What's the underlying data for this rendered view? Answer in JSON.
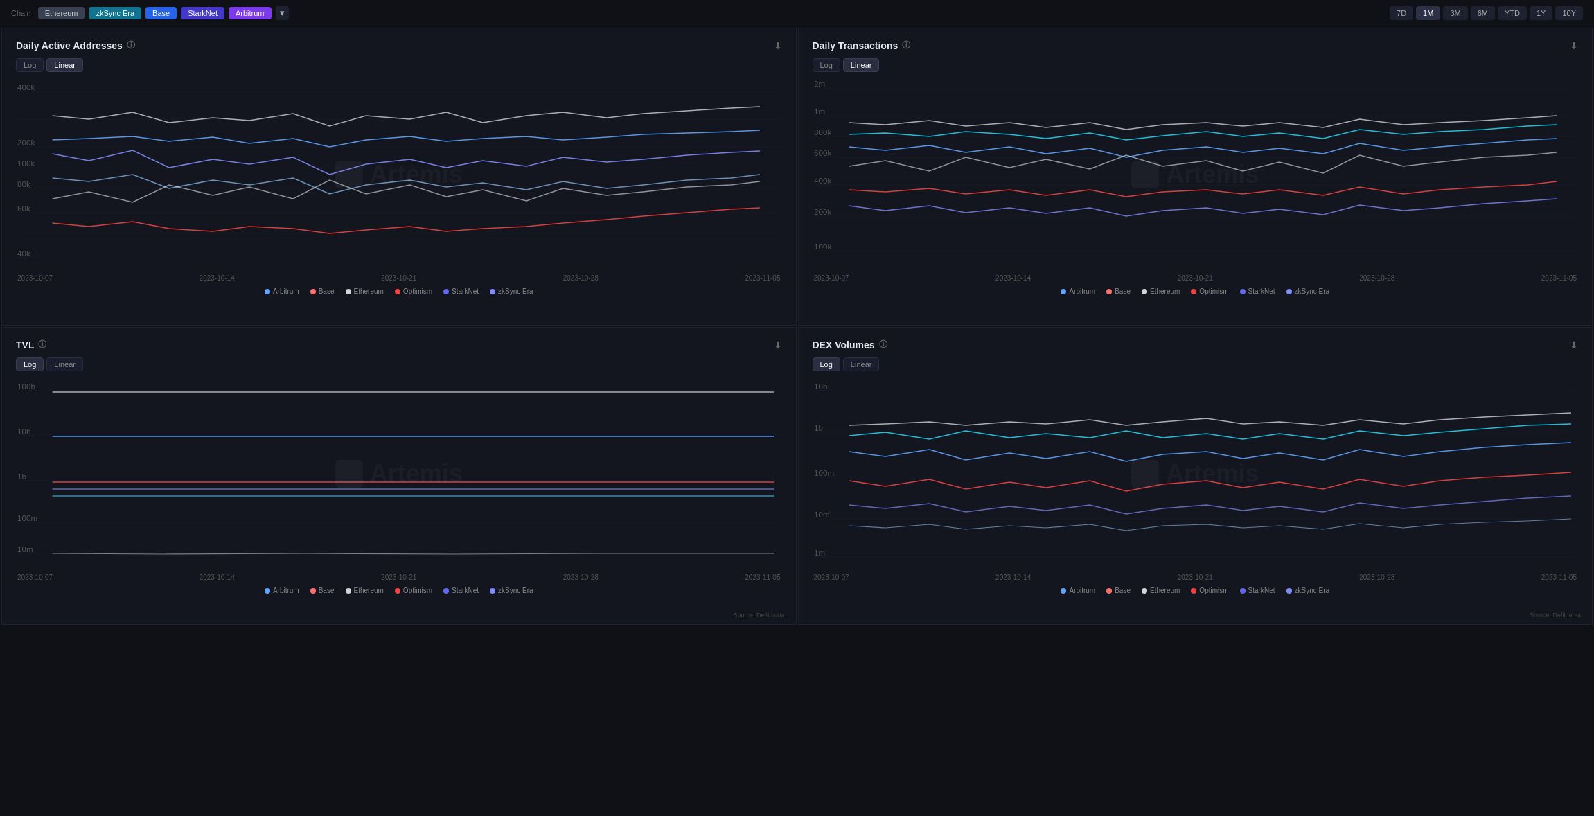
{
  "topBar": {
    "chainLabel": "Chain",
    "chains": [
      {
        "label": "Ethereum",
        "style": "active-gray"
      },
      {
        "label": "zkSync Era",
        "style": "active-cyan"
      },
      {
        "label": "Base",
        "style": "active-blue"
      },
      {
        "label": "StarkNet",
        "style": "active-indigo"
      },
      {
        "label": "Arbitrum",
        "style": "active-violet"
      }
    ],
    "timeFilters": [
      "7D",
      "1M",
      "3M",
      "6M",
      "YTD",
      "1Y",
      "10Y"
    ],
    "activeTime": "1M"
  },
  "panels": [
    {
      "id": "daily-active-addresses",
      "title": "Daily Active Addresses",
      "scaleButtons": [
        "Log",
        "Linear"
      ],
      "activeScale": "Linear",
      "yAxis": [
        "400k",
        "",
        "200k",
        "",
        "100k",
        "80k",
        "60k",
        "40k"
      ],
      "xAxis": [
        "2023-10-07",
        "2023-10-14",
        "2023-10-21",
        "2023-10-28",
        "2023-11-05"
      ],
      "legends": [
        {
          "label": "Arbitrum",
          "color": "#60a5fa"
        },
        {
          "label": "Base",
          "color": "#f87171"
        },
        {
          "label": "Ethereum",
          "color": "#d1d5db"
        },
        {
          "label": "Optimism",
          "color": "#ef4444"
        },
        {
          "label": "StarkNet",
          "color": "#6366f1"
        },
        {
          "label": "zkSync Era",
          "color": "#818cf8"
        }
      ]
    },
    {
      "id": "daily-transactions",
      "title": "Daily Transactions",
      "scaleButtons": [
        "Log",
        "Linear"
      ],
      "activeScale": "Linear",
      "yAxis": [
        "2m",
        "1m",
        "800k",
        "600k",
        "400k",
        "200k",
        "100k"
      ],
      "xAxis": [
        "2023-10-07",
        "2023-10-14",
        "2023-10-21",
        "2023-10-28",
        "2023-11-05"
      ],
      "legends": [
        {
          "label": "Arbitrum",
          "color": "#60a5fa"
        },
        {
          "label": "Base",
          "color": "#f87171"
        },
        {
          "label": "Ethereum",
          "color": "#d1d5db"
        },
        {
          "label": "Optimism",
          "color": "#ef4444"
        },
        {
          "label": "StarkNet",
          "color": "#6366f1"
        },
        {
          "label": "zkSync Era",
          "color": "#818cf8"
        }
      ]
    },
    {
      "id": "tvl",
      "title": "TVL",
      "scaleButtons": [
        "Log",
        "Linear"
      ],
      "activeScale": "Log",
      "yAxis": [
        "100b",
        "10b",
        "1b",
        "100m",
        "10m"
      ],
      "xAxis": [
        "2023-10-07",
        "2023-10-14",
        "2023-10-21",
        "2023-10-28",
        "2023-11-05"
      ],
      "legends": [
        {
          "label": "Arbitrum",
          "color": "#60a5fa"
        },
        {
          "label": "Base",
          "color": "#f87171"
        },
        {
          "label": "Ethereum",
          "color": "#d1d5db"
        },
        {
          "label": "Optimism",
          "color": "#ef4444"
        },
        {
          "label": "StarkNet",
          "color": "#6366f1"
        },
        {
          "label": "zkSync Era",
          "color": "#818cf8"
        }
      ]
    },
    {
      "id": "dex-volumes",
      "title": "DEX Volumes",
      "scaleButtons": [
        "Log",
        "Linear"
      ],
      "activeScale": "Log",
      "yAxis": [
        "10b",
        "1b",
        "100m",
        "10m",
        "1m"
      ],
      "xAxis": [
        "2023-10-07",
        "2023-10-14",
        "2023-10-21",
        "2023-10-28",
        "2023-11-05"
      ],
      "legends": [
        {
          "label": "Arbitrum",
          "color": "#60a5fa"
        },
        {
          "label": "Base",
          "color": "#f87171"
        },
        {
          "label": "Ethereum",
          "color": "#d1d5db"
        },
        {
          "label": "Optimism",
          "color": "#ef4444"
        },
        {
          "label": "StarkNet",
          "color": "#6366f1"
        },
        {
          "label": "zkSync Era",
          "color": "#818cf8"
        }
      ]
    }
  ],
  "watermark": "Artemis",
  "sourceLabel": "Source: DefiLlama",
  "icons": {
    "download": "⬇",
    "info": "ⓘ",
    "dropdown": "▾"
  }
}
